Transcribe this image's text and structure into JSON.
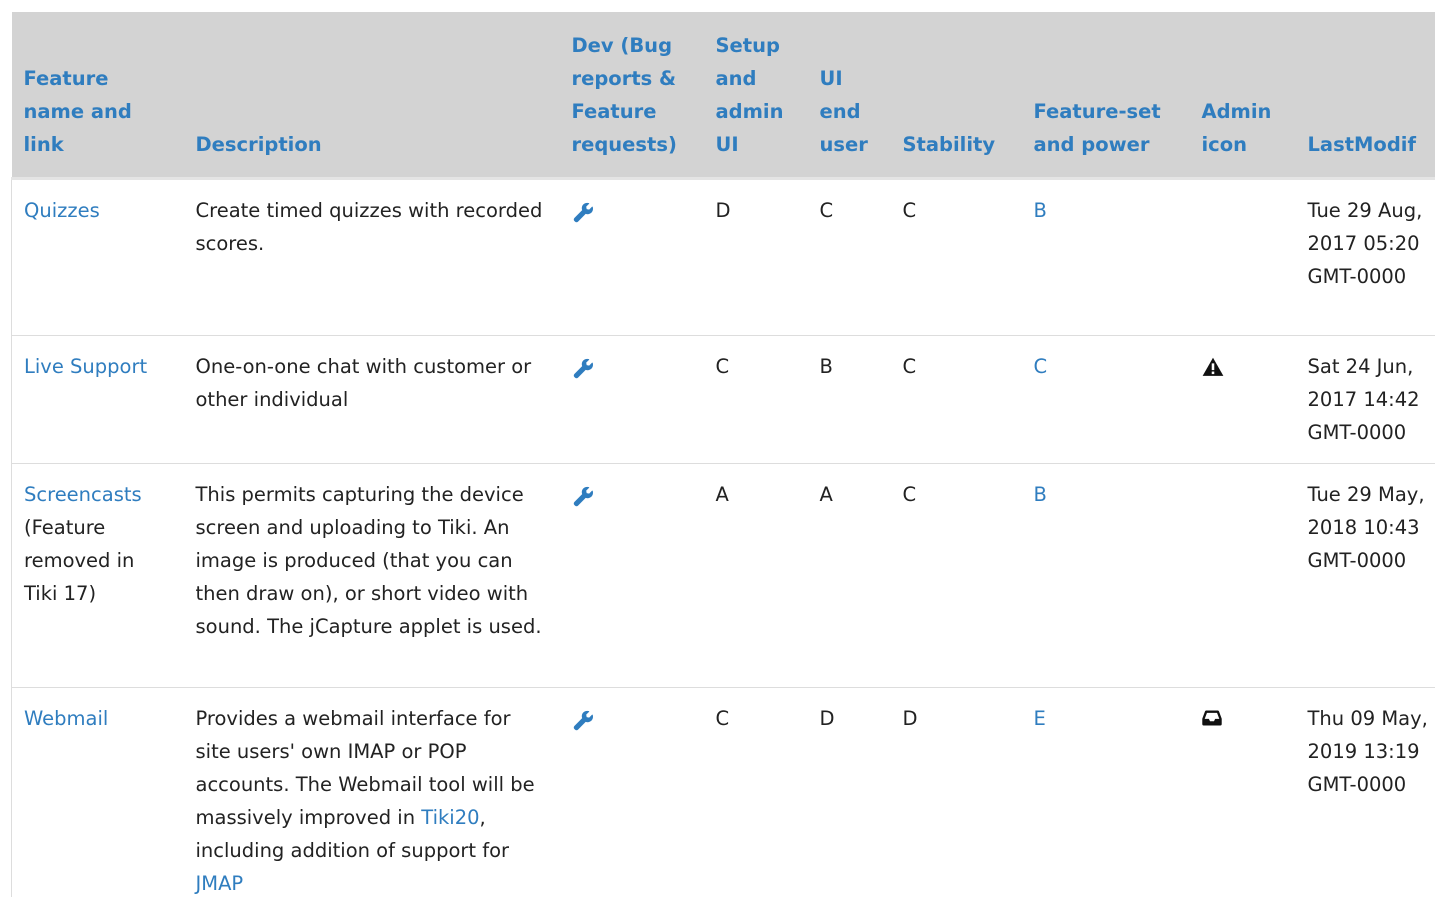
{
  "columns": [
    {
      "key": "feature",
      "label": "Feature name and link"
    },
    {
      "key": "description",
      "label": "Description"
    },
    {
      "key": "dev",
      "label": "Dev (Bug reports & Feature requests)"
    },
    {
      "key": "setup",
      "label": "Setup and admin UI"
    },
    {
      "key": "ui",
      "label": "UI end user"
    },
    {
      "key": "stability",
      "label": "Stability"
    },
    {
      "key": "featureset",
      "label": "Feature-set and power"
    },
    {
      "key": "admin_icon",
      "label": "Admin icon"
    },
    {
      "key": "lastmodif",
      "label": "LastModif"
    }
  ],
  "rows": [
    {
      "feature": "Quizzes",
      "feature_note": "",
      "description": "Create timed quizzes with recorded scores.",
      "dev_icon": "wrench-icon",
      "setup": "D",
      "ui": "C",
      "stability": "C",
      "featureset": "B",
      "admin_icon": "",
      "lastmodif": "Tue 29 Aug, 2017 05:20 GMT-0000"
    },
    {
      "feature": "Live Support",
      "feature_note": "",
      "description": "One-on-one chat with customer or other individual",
      "dev_icon": "wrench-icon",
      "setup": "C",
      "ui": "B",
      "stability": "C",
      "featureset": "C",
      "admin_icon": "warning-icon",
      "lastmodif": "Sat 24 Jun, 2017 14:42 GMT-0000"
    },
    {
      "feature": "Screencasts",
      "feature_note": "(Feature removed in Tiki 17)",
      "description": "This permits capturing the device screen and uploading to Tiki. An image is produced (that you can then draw on), or short video with sound. The jCapture applet is used.",
      "dev_icon": "wrench-icon",
      "setup": "A",
      "ui": "A",
      "stability": "C",
      "featureset": "B",
      "admin_icon": "",
      "lastmodif": "Tue 29 May, 2018 10:43 GMT-0000"
    },
    {
      "feature": "Webmail",
      "feature_note": "",
      "description_parts": {
        "before": "Provides a webmail interface for site users' own IMAP or POP accounts. The Webmail tool will be massively improved in ",
        "link1": "Tiki20",
        "middle": ", including addition of support for ",
        "link2": "JMAP"
      },
      "dev_icon": "wrench-icon",
      "setup": "C",
      "ui": "D",
      "stability": "D",
      "featureset": "E",
      "admin_icon": "inbox-icon",
      "lastmodif": "Thu 09 May, 2019 13:19 GMT-0000"
    }
  ],
  "colors": {
    "link": "#2f7dbf",
    "header_bg": "#d3d3d3",
    "text": "#222222",
    "border": "#dddddd"
  }
}
